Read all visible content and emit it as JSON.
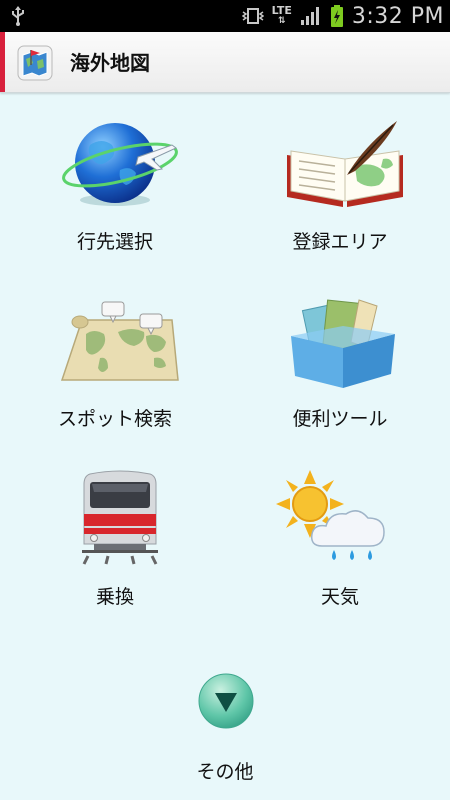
{
  "status_bar": {
    "time": "3:32 PM",
    "network": "LTE"
  },
  "app_bar": {
    "title": "海外地図"
  },
  "menu": {
    "items": [
      {
        "label": "行先選択"
      },
      {
        "label": "登録エリア"
      },
      {
        "label": "スポット検索"
      },
      {
        "label": "便利ツール"
      },
      {
        "label": "乗換"
      },
      {
        "label": "天気"
      }
    ],
    "more_label": "その他"
  },
  "colors": {
    "background": "#e8f8fa",
    "accent": "#d8203c",
    "more_button": "#5fc6a8"
  }
}
